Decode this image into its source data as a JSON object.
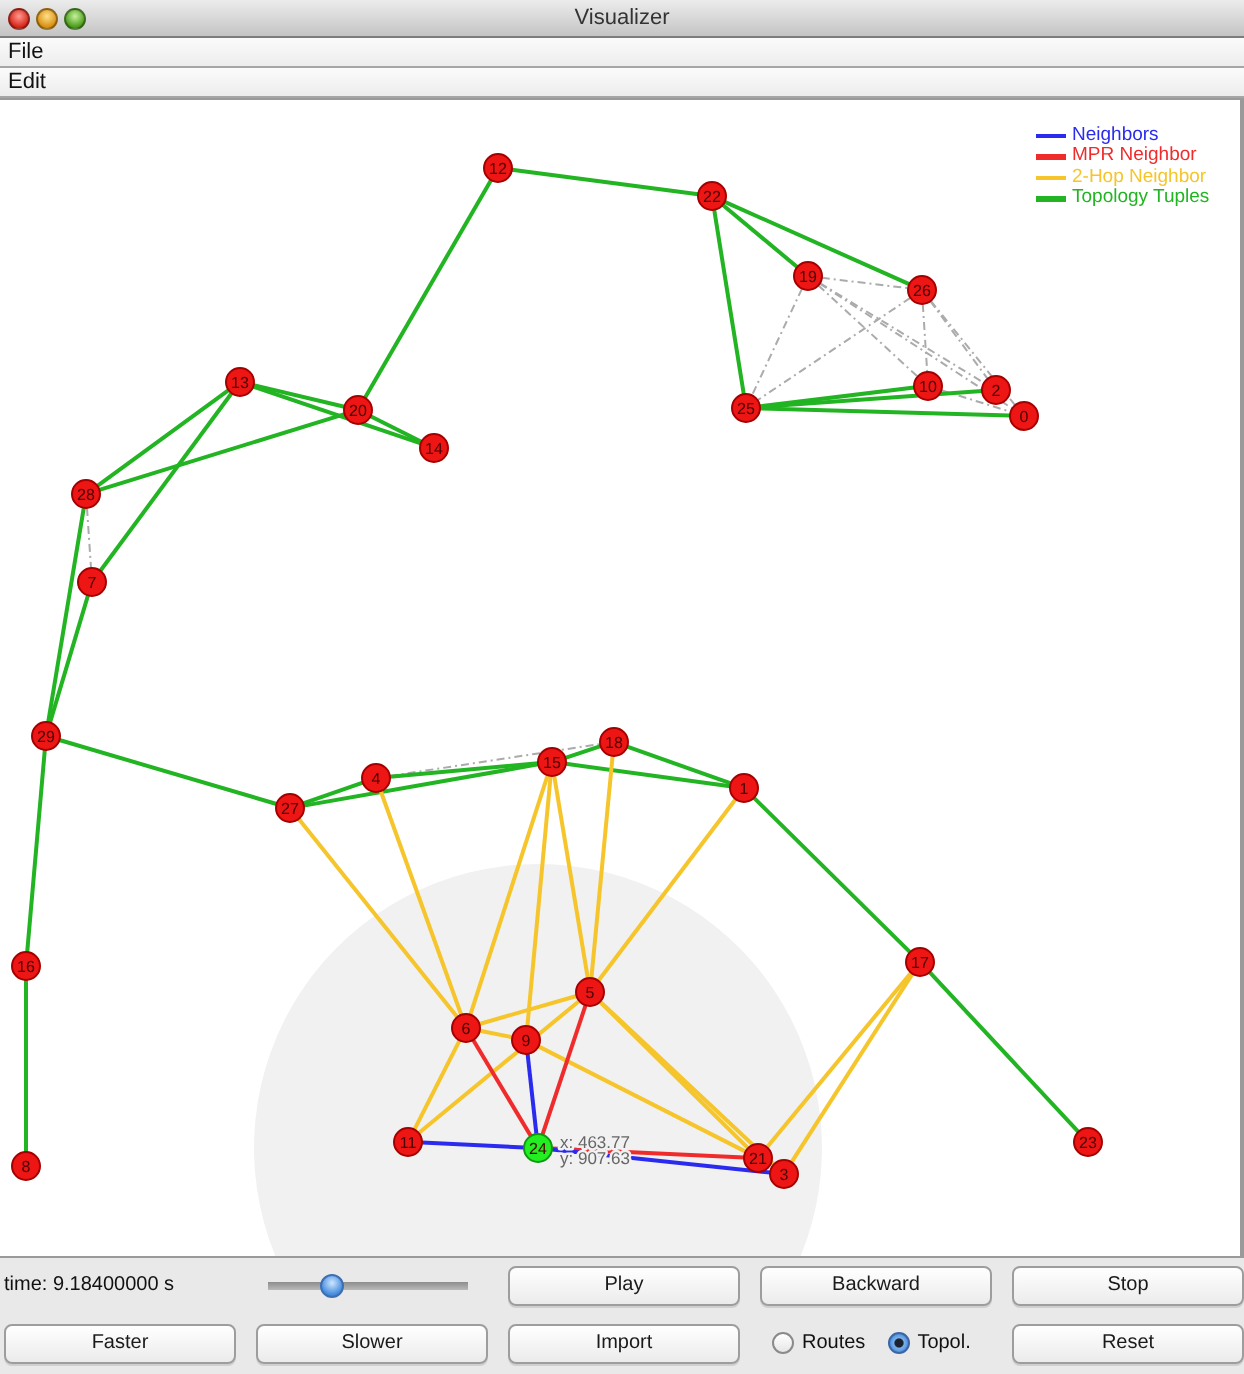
{
  "window": {
    "title": "Visualizer"
  },
  "menus": [
    {
      "label": "File"
    },
    {
      "label": "Edit"
    }
  ],
  "legend": [
    {
      "kind": "neighbor",
      "label": "Neighbors",
      "color": "#2b2bf0"
    },
    {
      "kind": "mpr",
      "label": "MPR Neighbor",
      "color": "#f02b2b"
    },
    {
      "kind": "two_hop",
      "label": "2-Hop Neighbor",
      "color": "#f5c52b"
    },
    {
      "kind": "topology",
      "label": "Topology Tuples",
      "color": "#22b422"
    }
  ],
  "graph": {
    "nodes": [
      {
        "label": "12",
        "selected": false
      },
      {
        "label": "22",
        "selected": false
      },
      {
        "label": "19",
        "selected": false
      },
      {
        "label": "26",
        "selected": false
      },
      {
        "label": "13",
        "selected": false
      },
      {
        "label": "20",
        "selected": false
      },
      {
        "label": "25",
        "selected": false
      },
      {
        "label": "10",
        "selected": false
      },
      {
        "label": "2",
        "selected": false
      },
      {
        "label": "0",
        "selected": false
      },
      {
        "label": "14",
        "selected": false
      },
      {
        "label": "28",
        "selected": false
      },
      {
        "label": "7",
        "selected": false
      },
      {
        "label": "29",
        "selected": false
      },
      {
        "label": "27",
        "selected": false
      },
      {
        "label": "4",
        "selected": false
      },
      {
        "label": "15",
        "selected": false
      },
      {
        "label": "18",
        "selected": false
      },
      {
        "label": "1",
        "selected": false
      },
      {
        "label": "16",
        "selected": false
      },
      {
        "label": "17",
        "selected": false
      },
      {
        "label": "5",
        "selected": false
      },
      {
        "label": "6",
        "selected": false
      },
      {
        "label": "9",
        "selected": false
      },
      {
        "label": "8",
        "selected": false
      },
      {
        "label": "11",
        "selected": false
      },
      {
        "label": "24",
        "selected": true,
        "readout": [
          "x: 463.77",
          "y: 907.63"
        ]
      },
      {
        "label": "21",
        "selected": false
      },
      {
        "label": "3",
        "selected": false
      },
      {
        "label": "23",
        "selected": false
      }
    ],
    "edges": [
      {
        "kind": "dashed"
      },
      {
        "kind": "dashed"
      },
      {
        "kind": "dashed"
      },
      {
        "kind": "dashed"
      },
      {
        "kind": "dashed"
      },
      {
        "kind": "dashed"
      },
      {
        "kind": "dashed"
      },
      {
        "kind": "dashed"
      },
      {
        "kind": "dashed"
      },
      {
        "kind": "dashed"
      },
      {
        "kind": "dashed"
      },
      {
        "kind": "dashed"
      },
      {
        "kind": "topology"
      },
      {
        "kind": "topology"
      },
      {
        "kind": "topology"
      },
      {
        "kind": "topology"
      },
      {
        "kind": "topology"
      },
      {
        "kind": "topology"
      },
      {
        "kind": "topology"
      },
      {
        "kind": "topology"
      },
      {
        "kind": "topology"
      },
      {
        "kind": "topology"
      },
      {
        "kind": "topology"
      },
      {
        "kind": "topology"
      },
      {
        "kind": "topology"
      },
      {
        "kind": "topology"
      },
      {
        "kind": "topology"
      },
      {
        "kind": "topology"
      },
      {
        "kind": "topology"
      },
      {
        "kind": "topology"
      },
      {
        "kind": "topology"
      },
      {
        "kind": "topology"
      },
      {
        "kind": "topology"
      },
      {
        "kind": "topology"
      },
      {
        "kind": "topology"
      },
      {
        "kind": "topology"
      },
      {
        "kind": "topology"
      },
      {
        "kind": "topology"
      },
      {
        "kind": "topology"
      },
      {
        "kind": "two_hop"
      },
      {
        "kind": "two_hop"
      },
      {
        "kind": "two_hop"
      },
      {
        "kind": "two_hop"
      },
      {
        "kind": "two_hop"
      },
      {
        "kind": "two_hop"
      },
      {
        "kind": "two_hop"
      },
      {
        "kind": "two_hop"
      },
      {
        "kind": "two_hop"
      },
      {
        "kind": "two_hop"
      },
      {
        "kind": "two_hop"
      },
      {
        "kind": "two_hop"
      },
      {
        "kind": "two_hop"
      },
      {
        "kind": "two_hop"
      },
      {
        "kind": "two_hop"
      },
      {
        "kind": "two_hop"
      },
      {
        "kind": "mpr"
      },
      {
        "kind": "mpr"
      },
      {
        "kind": "mpr"
      },
      {
        "kind": "neighbor"
      },
      {
        "kind": "neighbor"
      },
      {
        "kind": "neighbor"
      }
    ]
  },
  "toolbar": {
    "rows": [
      [
        {
          "kind": "label",
          "text": "time: 9.18400000 s"
        },
        {
          "kind": "slider",
          "level": 0.3
        },
        {
          "kind": "button",
          "label": "Play"
        },
        {
          "kind": "button",
          "label": "Backward"
        },
        {
          "kind": "button",
          "label": "Stop"
        }
      ],
      [
        {
          "kind": "button",
          "label": "Faster"
        },
        {
          "kind": "button",
          "label": "Slower"
        },
        {
          "kind": "button",
          "label": "Import"
        },
        {
          "kind": "radio_group",
          "options": [
            {
              "label": "Routes",
              "selected": false
            },
            {
              "label": "Topol.",
              "selected": true
            }
          ]
        },
        {
          "kind": "button",
          "label": "Reset"
        }
      ]
    ]
  }
}
